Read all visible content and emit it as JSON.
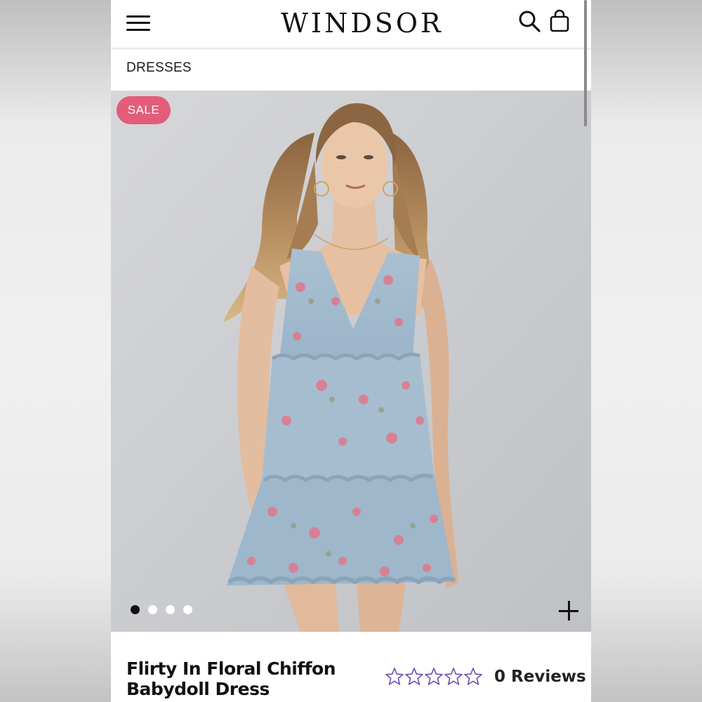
{
  "brand": {
    "logo_text": "WINDSOR"
  },
  "header": {
    "menu_icon": "hamburger-menu-icon",
    "search_icon": "search-icon",
    "bag_icon": "shopping-bag-icon"
  },
  "breadcrumb": {
    "label": "DRESSES"
  },
  "gallery": {
    "badge": "SALE",
    "badge_color": "#e35d78",
    "image_count": 4,
    "active_index": 0,
    "zoom_icon": "plus-icon"
  },
  "product": {
    "title": "Flirty In Floral Chiffon Babydoll Dress",
    "rating": 0,
    "rating_max": 5,
    "star_color": "#6b4fb0",
    "reviews_label": "0 Reviews"
  }
}
